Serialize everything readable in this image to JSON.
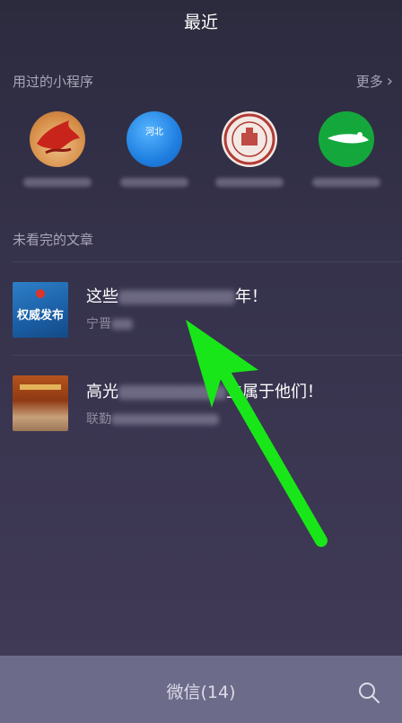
{
  "header": {
    "title": "最近"
  },
  "mini_programs": {
    "label": "用过的小程序",
    "more_label": "更多",
    "items": [
      {
        "icon": "red-dragon-icon"
      },
      {
        "icon": "hebei-globe-icon",
        "badge": "河北"
      },
      {
        "icon": "school-emblem-icon"
      },
      {
        "icon": "green-app-icon"
      }
    ]
  },
  "articles": {
    "label": "未看完的文章",
    "items": [
      {
        "title_start": "这些",
        "title_end": "年！",
        "source": "宁晋",
        "thumb_text": "权威发布"
      },
      {
        "title_start": "高光",
        "title_end": "立属于他们！",
        "source": "联勤"
      }
    ]
  },
  "bottom_bar": {
    "label": "微信(14)"
  },
  "colors": {
    "arrow": "#19e619",
    "bottom_bar": "#6d6b8a"
  }
}
